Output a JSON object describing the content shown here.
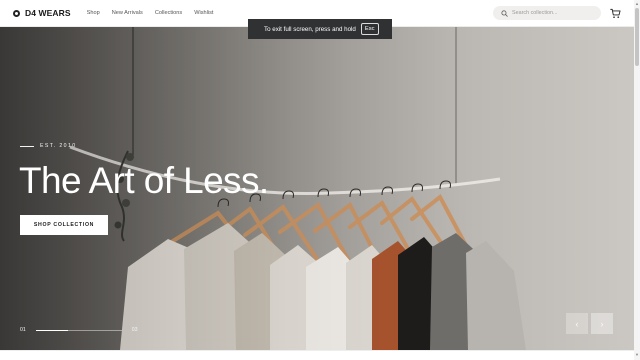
{
  "brand": {
    "name": "D4 WEARS"
  },
  "nav": {
    "items": [
      "Shop",
      "New Arrivals",
      "Collections",
      "Wishlist"
    ]
  },
  "search": {
    "placeholder": "Search collection..."
  },
  "toast": {
    "message": "To exit full screen, press and hold",
    "key": "Esc"
  },
  "hero": {
    "eyebrow": "EST. 2010",
    "headline": "The Art of Less.",
    "cta_label": "SHOP COLLECTION",
    "current_slide": "01",
    "total_slides": "03",
    "progress_fraction": 0.37,
    "prev_label": "‹",
    "next_label": "›"
  },
  "icons": {
    "logo": "logo-mark-icon",
    "search": "search-icon",
    "cart": "cart-icon",
    "prev": "chevron-left-icon",
    "next": "chevron-right-icon"
  },
  "colors": {
    "toast_bg": "#2f3133",
    "search_bg": "#f1efed",
    "cta_bg": "#ffffff",
    "text_dark": "#1a1a1a"
  }
}
